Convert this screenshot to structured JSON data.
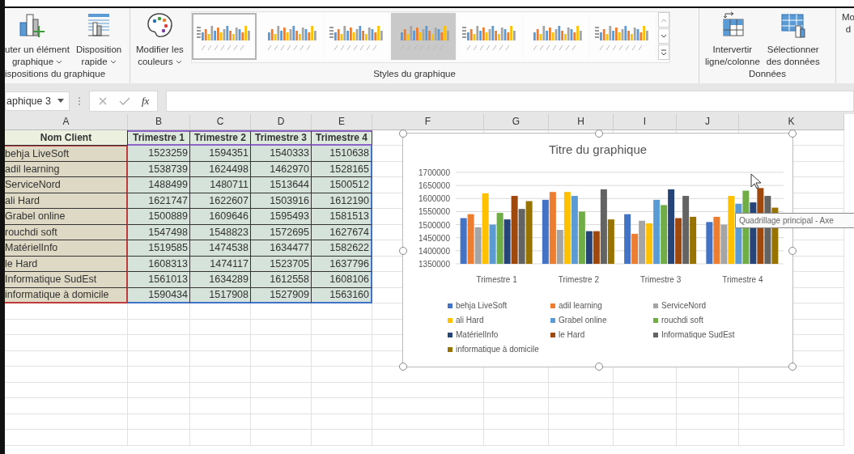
{
  "ribbon": {
    "groups": [
      {
        "label": "ispositions du graphique",
        "buttons": [
          {
            "lines": [
              "uter un élément",
              "graphique"
            ],
            "dropdown": true
          },
          {
            "lines": [
              "Disposition",
              "rapide"
            ],
            "dropdown": true
          }
        ]
      },
      {
        "label": "Styles du graphique",
        "buttons": [
          {
            "lines": [
              "Modifier les",
              "couleurs"
            ],
            "dropdown": true
          }
        ],
        "gallery": [
          {
            "selected": true
          },
          {
            "selected": false
          },
          {
            "selected": false
          },
          {
            "selected": false
          },
          {
            "selected": false
          },
          {
            "selected": false
          },
          {
            "selected": false
          }
        ]
      },
      {
        "label": "Données",
        "buttons": [
          {
            "lines": [
              "Intervertir",
              "ligne/colonne"
            ],
            "dropdown": false
          },
          {
            "lines": [
              "Sélectionner",
              "des données"
            ],
            "dropdown": false
          }
        ]
      },
      {
        "buttons": [
          {
            "lines": [
              "Mo",
              "d"
            ],
            "dropdown": false
          }
        ]
      }
    ]
  },
  "formula_bar": {
    "name_box": "aphique 3",
    "fx": "fx"
  },
  "sheet": {
    "columns": [
      "A",
      "B",
      "C",
      "D",
      "E",
      "F",
      "G",
      "H",
      "I",
      "J",
      "K"
    ],
    "header": [
      "Nom Client",
      "Trimestre 1",
      "Trimestre 2",
      "Trimestre 3",
      "Trimestre 4"
    ],
    "rows": [
      {
        "name": "behja LiveSoft",
        "values": [
          "1523259",
          "1594351",
          "1540333",
          "1510638"
        ]
      },
      {
        "name": "adil learning",
        "values": [
          "1538739",
          "1624498",
          "1462970",
          "1528165"
        ]
      },
      {
        "name": "ServiceNord",
        "values": [
          "1488499",
          "1480711",
          "1513644",
          "1500512"
        ]
      },
      {
        "name": "ali Hard",
        "values": [
          "1621747",
          "1622607",
          "1503916",
          "1612190"
        ]
      },
      {
        "name": "Grabel online",
        "values": [
          "1500889",
          "1609646",
          "1595493",
          "1581513"
        ]
      },
      {
        "name": "rouchdi soft",
        "values": [
          "1547498",
          "1548823",
          "1572695",
          "1627674"
        ]
      },
      {
        "name": "MatérielInfo",
        "values": [
          "1519585",
          "1474538",
          "1634477",
          "1582622"
        ]
      },
      {
        "name": "le Hard",
        "values": [
          "1608313",
          "1474117",
          "1523705",
          "1637796"
        ]
      },
      {
        "name": "Informatique SudEst",
        "values": [
          "1561013",
          "1634289",
          "1612558",
          "1608106"
        ]
      },
      {
        "name": "informatique à domicile",
        "values": [
          "1590434",
          "1517908",
          "1527909",
          "1563160"
        ]
      }
    ]
  },
  "chart": {
    "chart_data": {
      "type": "bar",
      "title": "Titre du graphique",
      "categories": [
        "Trimestre 1",
        "Trimestre 2",
        "Trimestre 3",
        "Trimestre 4"
      ],
      "ylim": [
        1350000,
        1700000
      ],
      "grid": true,
      "yticks": [
        1350000,
        1400000,
        1450000,
        1500000,
        1550000,
        1600000,
        1650000,
        1700000
      ],
      "series": [
        {
          "name": "behja LiveSoft",
          "color": "#4472c4",
          "values": [
            1525000,
            1595000,
            1540000,
            1510000
          ]
        },
        {
          "name": "adil learning",
          "color": "#ed7d31",
          "values": [
            1540000,
            1625000,
            1465000,
            1530000
          ]
        },
        {
          "name": "ServiceNord",
          "color": "#a5a5a5",
          "values": [
            1490000,
            1480000,
            1515000,
            1500000
          ]
        },
        {
          "name": "ali Hard",
          "color": "#ffc000",
          "values": [
            1620000,
            1625000,
            1505000,
            1610000
          ]
        },
        {
          "name": "Grabel online",
          "color": "#5b9bd5",
          "values": [
            1500000,
            1610000,
            1595000,
            1580000
          ]
        },
        {
          "name": "rouchdi soft",
          "color": "#70ad47",
          "values": [
            1545000,
            1550000,
            1575000,
            1630000
          ]
        },
        {
          "name": "MatérielInfo",
          "color": "#264478",
          "values": [
            1520000,
            1475000,
            1635000,
            1585000
          ]
        },
        {
          "name": "le Hard",
          "color": "#9e480e",
          "values": [
            1610000,
            1475000,
            1525000,
            1640000
          ]
        },
        {
          "name": "Informatique SudEst",
          "color": "#636363",
          "values": [
            1560000,
            1635000,
            1610000,
            1610000
          ]
        },
        {
          "name": "informatique à domicile",
          "color": "#997300",
          "values": [
            1590000,
            1520000,
            1530000,
            1565000
          ]
        }
      ]
    },
    "tooltip": "Quadrillage principal - Axe"
  }
}
